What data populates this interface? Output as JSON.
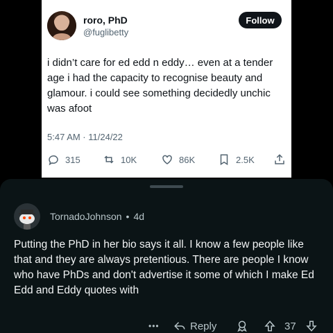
{
  "tweet": {
    "display_name": "roro, PhD",
    "handle": "@fuglibetty",
    "follow_label": "Follow",
    "text": "i didn’t care for ed edd n eddy… even at a tender age i had the capacity to recognise beauty and glamour. i could see something decidedly unchic was afoot",
    "timestamp": "5:47 AM · 11/24/22",
    "replies": "315",
    "retweets": "10K",
    "likes": "86K",
    "bookmarks": "2.5K",
    "icons": [
      "reply-icon",
      "retweet-icon",
      "heart-icon",
      "bookmark-icon",
      "share-icon"
    ]
  },
  "comment": {
    "author": "TornadoJohnson",
    "separator": "•",
    "age": "4d",
    "body": "Putting the PhD in her bio says it all.  I know a few people like that and they are always pretentious. There are people I know who have PhDs and don't advertise it some of which I make Ed Edd and Eddy quotes with",
    "more_label": "•••",
    "reply_label": "Reply",
    "score": "37",
    "icons": [
      "more-icon",
      "reply-arrow-icon",
      "award-icon",
      "upvote-icon",
      "downvote-icon"
    ]
  },
  "colors": {
    "page_bg": "#000000",
    "tweet_bg": "#ffffff",
    "sheet_bg": "#0b1416",
    "muted_text": "#b8c5c9"
  }
}
